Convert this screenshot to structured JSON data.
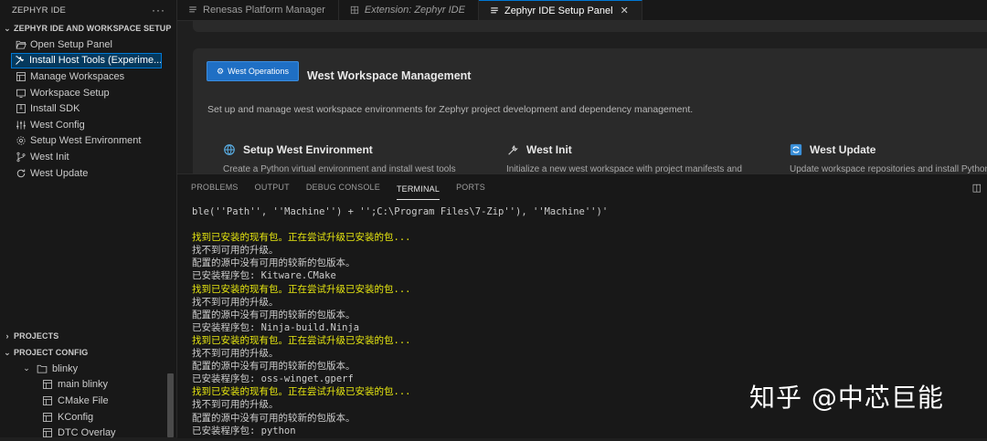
{
  "sidebar": {
    "title": "ZEPHYR IDE",
    "more": "···",
    "section": "ZEPHYR IDE AND WORKSPACE SETUP",
    "items": [
      {
        "label": "Open Setup Panel",
        "icon": "folder-open-icon"
      },
      {
        "label": "Install Host Tools (Experime...",
        "icon": "tools-icon"
      },
      {
        "label": "Manage Workspaces",
        "icon": "workspace-icon"
      },
      {
        "label": "Workspace Setup",
        "icon": "workspace-setup-icon"
      },
      {
        "label": "Install SDK",
        "icon": "archive-icon"
      },
      {
        "label": "West Config",
        "icon": "settings-sliders-icon"
      },
      {
        "label": "Setup West Environment",
        "icon": "gear-icon"
      },
      {
        "label": "West Init",
        "icon": "branch-icon"
      },
      {
        "label": "West Update",
        "icon": "refresh-icon"
      }
    ],
    "projects": "PROJECTS",
    "project_config": "PROJECT CONFIG",
    "tree": {
      "blinky": "blinky",
      "children": [
        "main blinky",
        "CMake File",
        "KConfig",
        "DTC Overlay"
      ]
    }
  },
  "tabs": [
    {
      "label": "Renesas Platform Manager",
      "italic": false
    },
    {
      "label": "Extension: Zephyr IDE",
      "italic": true
    },
    {
      "label": "Zephyr IDE Setup Panel",
      "active": true
    }
  ],
  "webview": {
    "button": "West Operations",
    "title": "West Workspace Management",
    "description": "Set up and manage west workspace environments for Zephyr project development and dependency management.",
    "features": [
      {
        "title": "Setup West Environment",
        "desc": "Create a Python virtual environment and install west tools",
        "icon": "globe-icon"
      },
      {
        "title": "West Init",
        "desc": "Initialize a new west workspace with project manifests and",
        "icon": "wrench-icon"
      },
      {
        "title": "West Update",
        "desc": "Update workspace repositories and install Python",
        "icon": "sync-icon"
      }
    ]
  },
  "panel": {
    "tabs": [
      "PROBLEMS",
      "OUTPUT",
      "DEBUG CONSOLE",
      "TERMINAL",
      "PORTS"
    ],
    "active_tab": "TERMINAL",
    "terminal_lines": [
      {
        "text": "ble(''Path'', ''Machine'') + '';C:\\Program Files\\7-Zip''), ''Machine'')'",
        "color": "w"
      },
      {
        "text": "",
        "color": "w"
      },
      {
        "text": "找到已安装的现有包。正在尝试升级已安装的包...",
        "color": "y"
      },
      {
        "text": "找不到可用的升级。",
        "color": "w"
      },
      {
        "text": "配置的源中没有可用的较新的包版本。",
        "color": "w"
      },
      {
        "text": "已安装程序包: Kitware.CMake",
        "color": "w"
      },
      {
        "text": "找到已安装的现有包。正在尝试升级已安装的包...",
        "color": "y"
      },
      {
        "text": "找不到可用的升级。",
        "color": "w"
      },
      {
        "text": "配置的源中没有可用的较新的包版本。",
        "color": "w"
      },
      {
        "text": "已安装程序包: Ninja-build.Ninja",
        "color": "w"
      },
      {
        "text": "找到已安装的现有包。正在尝试升级已安装的包...",
        "color": "y"
      },
      {
        "text": "找不到可用的升级。",
        "color": "w"
      },
      {
        "text": "配置的源中没有可用的较新的包版本。",
        "color": "w"
      },
      {
        "text": "已安装程序包: oss-winget.gperf",
        "color": "w"
      },
      {
        "text": "找到已安装的现有包。正在尝试升级已安装的包...",
        "color": "y"
      },
      {
        "text": "找不到可用的升级。",
        "color": "w"
      },
      {
        "text": "配置的源中没有可用的较新的包版本。",
        "color": "w"
      },
      {
        "text": "已安装程序包: python",
        "color": "w"
      }
    ]
  },
  "watermark": "知乎 @中芯巨能",
  "colors": {
    "accent": "#0078d4",
    "terminal_yellow": "#e5e510",
    "button_blue": "#1f6fc4"
  }
}
